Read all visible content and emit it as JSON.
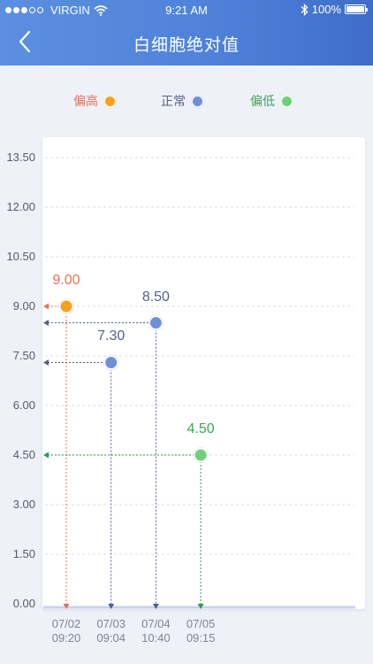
{
  "status_bar": {
    "carrier": "VIRGIN",
    "time": "9:21 AM",
    "battery": "100%"
  },
  "nav": {
    "title": "白细胞绝对值",
    "back_icon": "chevron-left-icon"
  },
  "legend": [
    {
      "label": "偏高",
      "color": "#f5a020",
      "text_color": "#e8705c"
    },
    {
      "label": "正常",
      "color": "#6f8fd8",
      "text_color": "#55608a"
    },
    {
      "label": "偏低",
      "color": "#6ed07a",
      "text_color": "#3aa857"
    }
  ],
  "chart_data": {
    "type": "scatter",
    "y_ticks": [
      "13.50",
      "12.00",
      "10.50",
      "9.00",
      "7.50",
      "6.00",
      "4.50",
      "3.00",
      "1.50",
      "0.00"
    ],
    "ylim": [
      0,
      13.5
    ],
    "grid": true,
    "points": [
      {
        "date": "07/02",
        "time": "09:20",
        "value": 9.0,
        "label": "9.00",
        "status": "high",
        "color": "#f5a020",
        "label_color": "#e8705c",
        "line_color": "#e8705c"
      },
      {
        "date": "07/03",
        "time": "09:04",
        "value": 7.3,
        "label": "7.30",
        "status": "normal",
        "color": "#6f8fd8",
        "label_color": "#55608a",
        "line_color": "#4f5f95"
      },
      {
        "date": "07/04",
        "time": "10:40",
        "value": 8.5,
        "label": "8.50",
        "status": "normal",
        "color": "#6f8fd8",
        "label_color": "#55608a",
        "line_color": "#4f5f95"
      },
      {
        "date": "07/05",
        "time": "09:15",
        "value": 4.5,
        "label": "4.50",
        "status": "low",
        "color": "#6ed07a",
        "label_color": "#3aa857",
        "line_color": "#2f9a4e"
      }
    ]
  }
}
